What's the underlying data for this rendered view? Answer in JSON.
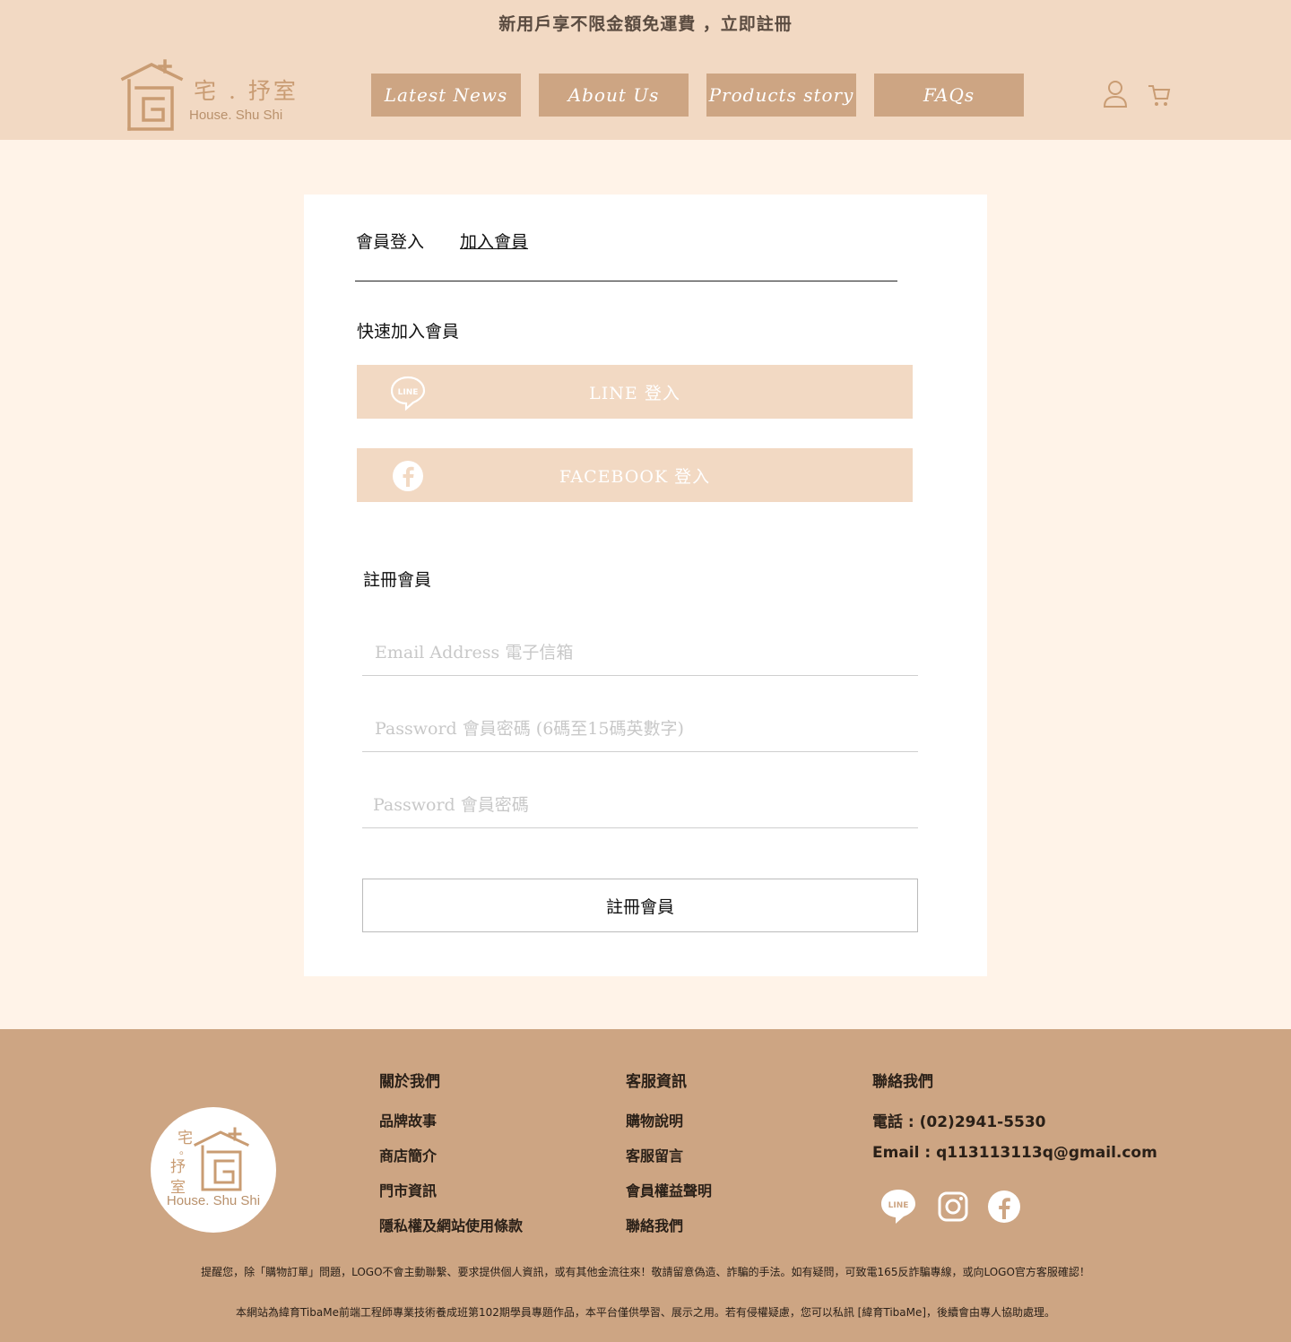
{
  "promo": "新用戶享不限金額免運費 ，立即註冊",
  "logo": {
    "cn": "宅 . 抒室",
    "en": "House. Shu Shi"
  },
  "nav": [
    "Latest News",
    "About Us",
    "Products story",
    "FAQs"
  ],
  "tabs": {
    "login": "會員登入",
    "join": "加入會員"
  },
  "quick": {
    "title": "快速加入會員",
    "line_label": "LINE 登入",
    "facebook_label": "FACEBOOK 登入"
  },
  "register": {
    "title": "註冊會員",
    "email_placeholder": "Email Address 電子信箱",
    "password_placeholder": "Password 會員密碼 (6碼至15碼英數字)",
    "confirm_placeholder": "Password 會員密碼",
    "submit_label": "註冊會員"
  },
  "footer": {
    "logo": {
      "cn_top": "宅",
      "cn_mid": "抒",
      "cn_bot": "室",
      "en": "House. Shu Shi"
    },
    "about": {
      "title": "關於我們",
      "links": [
        "品牌故事",
        "商店簡介",
        "門市資訊",
        "隱私權及網站使用條款"
      ]
    },
    "service": {
      "title": "客服資訊",
      "links": [
        "購物說明",
        "客服留言",
        "會員權益聲明",
        "聯絡我們"
      ]
    },
    "contact": {
      "title": "聯絡我們",
      "phone": "電話 : (02)2941-5530",
      "email": "Email : q113113113q@gmail.com"
    },
    "notice": "提醒您，除「購物訂單」問題，LOGO不會主動聯繫、要求提供個人資訊，或有其他金流往來！敬請留意偽造、詐騙的手法。如有疑問，可致電165反詐騙專線，或向LOGO官方客服確認！",
    "disclaimer": "本網站為緯育TibaMe前端工程師專業技術養成班第102期學員專題作品，本平台僅供學習、展示之用。若有侵權疑慮，您可以私訊 [緯育TibaMe]，後續會由專人協助處理。"
  },
  "colors": {
    "header_bg": "#f2d9c3",
    "page_bg": "#fff3e8",
    "accent": "#cda583",
    "icon": "#c99c73"
  }
}
